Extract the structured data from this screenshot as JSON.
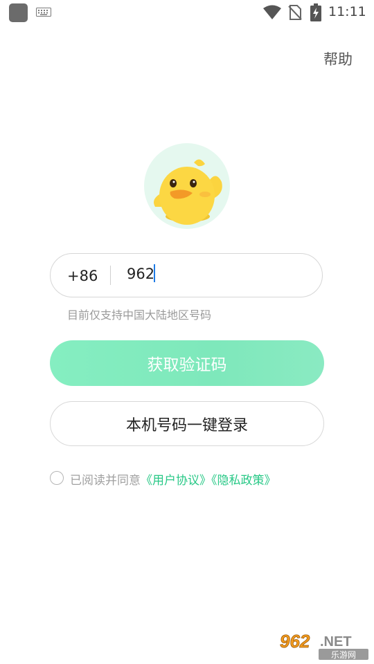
{
  "status_bar": {
    "time": "11:11",
    "icons": [
      "app-icon",
      "keyboard-icon",
      "wifi-icon",
      "no-sim-icon",
      "battery-charging-icon"
    ]
  },
  "header": {
    "help_label": "帮助"
  },
  "avatar": {
    "icon": "duck-avatar-icon"
  },
  "phone": {
    "country_code": "+86",
    "value": "962",
    "hint": "目前仅支持中国大陆地区号码"
  },
  "buttons": {
    "get_code": "获取验证码",
    "one_key_login": "本机号码一键登录"
  },
  "agreement": {
    "prefix": "已阅读并同意",
    "user_agreement": "《用户协议》",
    "privacy_policy": "《隐私政策》"
  },
  "watermark": {
    "number": "962",
    "domain": ".NET",
    "site_name": "乐游网"
  },
  "colors": {
    "accent_green": "#27c886",
    "button_green": "#85eec1",
    "caret_blue": "#1e7be6"
  }
}
